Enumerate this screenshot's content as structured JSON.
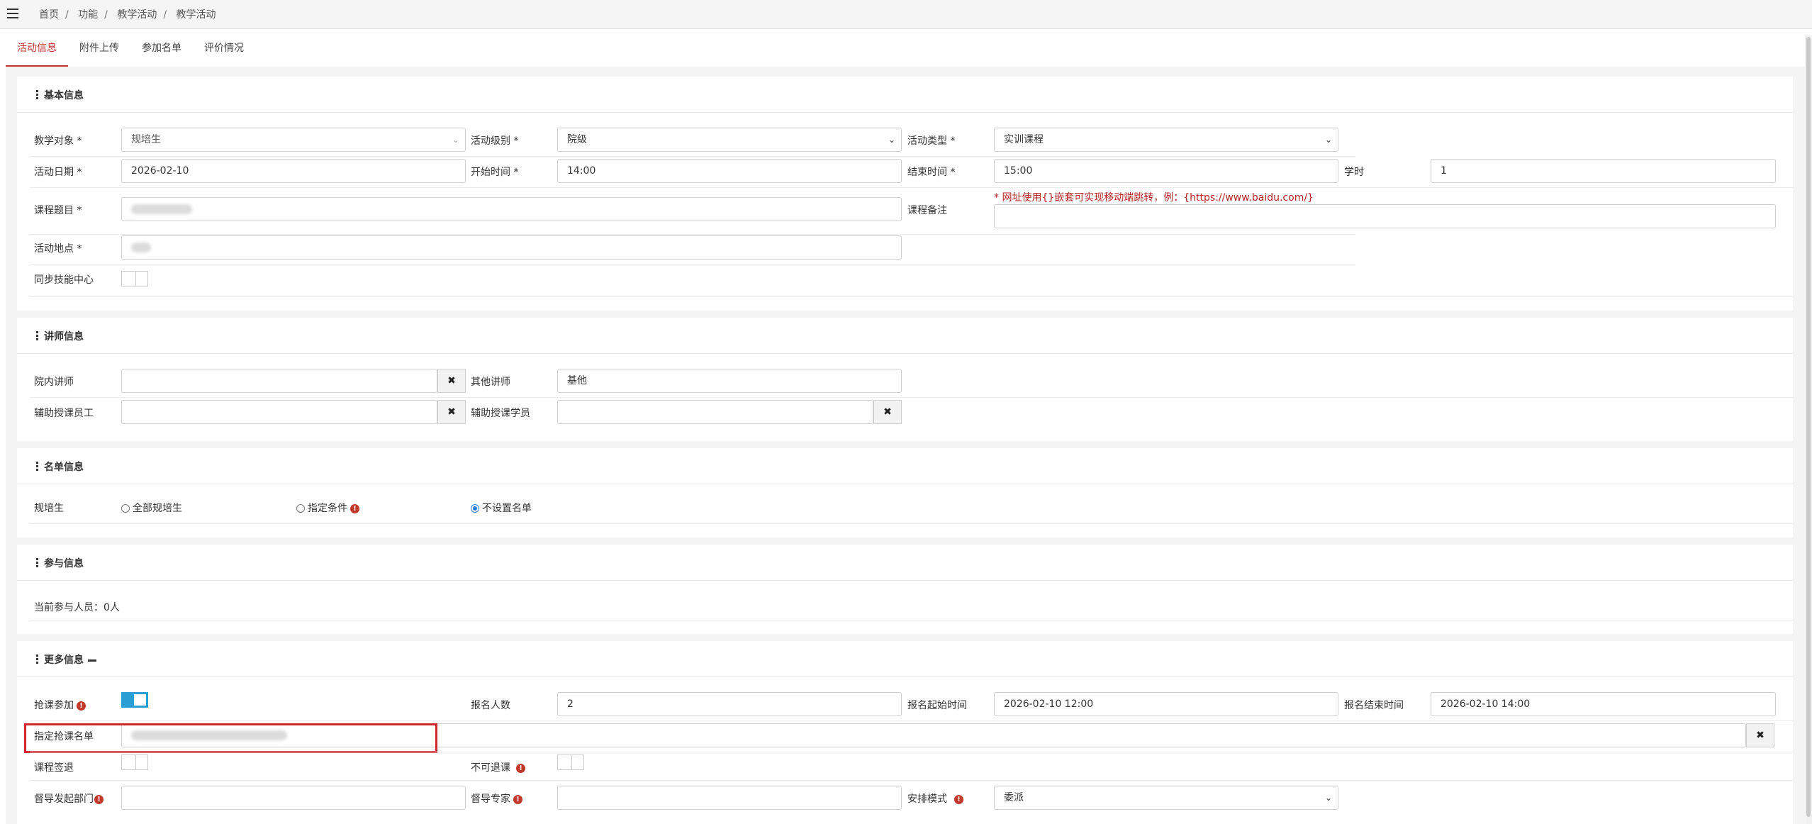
{
  "breadcrumb": [
    "首页",
    "功能",
    "教学活动",
    "教学活动"
  ],
  "tabs": [
    "活动信息",
    "附件上传",
    "参加名单",
    "评价情况"
  ],
  "basic": {
    "title": "基本信息",
    "teach_target_label": "教学对象 *",
    "teach_target_value": "规培生",
    "activity_level_label": "活动级别 *",
    "activity_level_value": "院级",
    "activity_type_label": "活动类型 *",
    "activity_type_value": "实训课程",
    "date_label": "活动日期 *",
    "date_value": "2026-02-10",
    "start_label": "开始时间 *",
    "start_value": "14:00",
    "end_label": "结束时间 *",
    "end_value": "15:00",
    "hours_label": "学时",
    "hours_value": "1",
    "course_title_label": "课程题目 *",
    "course_remark_label": "课程备注",
    "course_remark_hint": "* 网址使用{}嵌套可实现移动端跳转，例：{https://www.baidu.com/}",
    "location_label": "活动地点 *",
    "sync_label": "同步技能中心"
  },
  "lecturer": {
    "title": "讲师信息",
    "internal_label": "院内讲师",
    "other_label": "其他讲师",
    "other_value": "基他",
    "assist_staff_label": "辅助授课员工",
    "assist_student_label": "辅助授课学员"
  },
  "roster": {
    "title": "名单信息",
    "trainee_label": "规培生",
    "options": [
      "全部规培生",
      "指定条件",
      "不设置名单"
    ],
    "selected": "不设置名单"
  },
  "participation": {
    "title": "参与信息",
    "current_text": "当前参与人员：0人"
  },
  "more": {
    "title": "更多信息",
    "grab_label": "抢课参加",
    "signup_count_label": "报名人数",
    "signup_count_value": "2",
    "signup_start_label": "报名起始时间",
    "signup_start_value": "2026-02-10 12:00",
    "signup_end_label": "报名结束时间",
    "signup_end_value": "2026-02-10 14:00",
    "designated_label": "指定抢课名单",
    "course_signout_label": "课程签退",
    "no_withdraw_label": "不可退课",
    "supervise_dept_label": "督导发起部门",
    "supervise_expert_label": "督导专家",
    "arrange_mode_label": "安排模式",
    "arrange_mode_value": "委派"
  },
  "icons": {
    "clear": "✖",
    "chevron": "⌄",
    "info": "!"
  }
}
